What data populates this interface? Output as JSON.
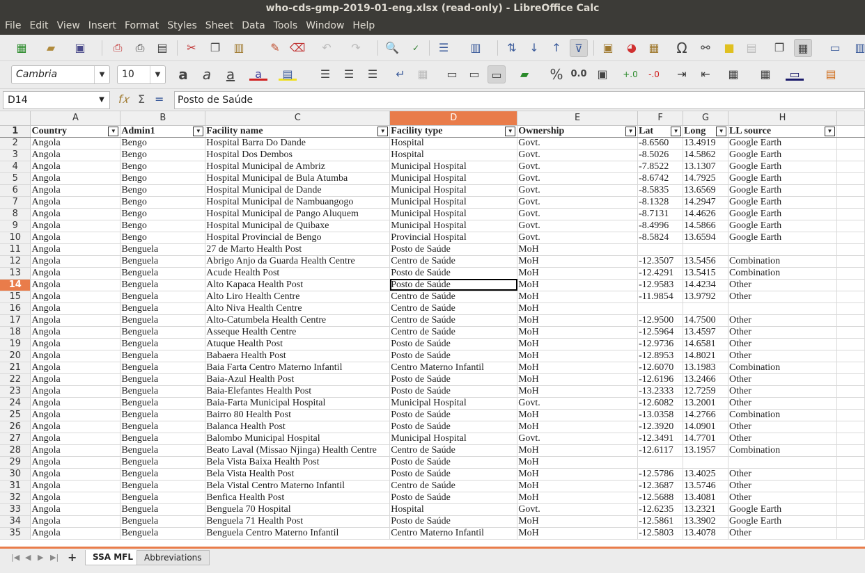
{
  "window": {
    "title": "who-cds-gmp-2019-01-eng.xlsx (read-only) - LibreOffice Calc"
  },
  "menu": [
    "File",
    "Edit",
    "View",
    "Insert",
    "Format",
    "Styles",
    "Sheet",
    "Data",
    "Tools",
    "Window",
    "Help"
  ],
  "format_toolbar": {
    "font_name": "Cambria",
    "font_size": "10"
  },
  "formula_bar": {
    "cell_ref": "D14",
    "content": "Posto de Saúde"
  },
  "columns": [
    "A",
    "B",
    "C",
    "D",
    "E",
    "F",
    "G",
    "H"
  ],
  "selected_column": "D",
  "selected_row": "14",
  "headers": [
    "Country",
    "Admin1",
    "Facility name",
    "Facility type",
    "Ownership",
    "Lat",
    "Long",
    "LL source"
  ],
  "rows": [
    [
      "2",
      "Angola",
      "Bengo",
      "Hospital Barra Do Dande",
      "Hospital",
      "Govt.",
      "-8.6560",
      "13.4919",
      "Google Earth"
    ],
    [
      "3",
      "Angola",
      "Bengo",
      "Hospital Dos Dembos",
      "Hospital",
      "Govt.",
      "-8.5026",
      "14.5862",
      "Google Earth"
    ],
    [
      "4",
      "Angola",
      "Bengo",
      "Hospital Municipal de Ambriz",
      "Municipal Hospital",
      "Govt.",
      "-7.8522",
      "13.1307",
      "Google Earth"
    ],
    [
      "5",
      "Angola",
      "Bengo",
      "Hospital Municipal de Bula Atumba",
      "Municipal Hospital",
      "Govt.",
      "-8.6742",
      "14.7925",
      "Google Earth"
    ],
    [
      "6",
      "Angola",
      "Bengo",
      "Hospital Municipal de Dande",
      "Municipal Hospital",
      "Govt.",
      "-8.5835",
      "13.6569",
      "Google Earth"
    ],
    [
      "7",
      "Angola",
      "Bengo",
      "Hospital Municipal de Nambuangogo",
      "Municipal Hospital",
      "Govt.",
      "-8.1328",
      "14.2947",
      "Google Earth"
    ],
    [
      "8",
      "Angola",
      "Bengo",
      "Hospital Municipal de Pango Aluquem",
      "Municipal Hospital",
      "Govt.",
      "-8.7131",
      "14.4626",
      "Google Earth"
    ],
    [
      "9",
      "Angola",
      "Bengo",
      "Hospital Municipal de Quibaxe",
      "Municipal Hospital",
      "Govt.",
      "-8.4996",
      "14.5866",
      "Google Earth"
    ],
    [
      "10",
      "Angola",
      "Bengo",
      "Hospital Provincial de Bengo",
      "Provincial Hospital",
      "Govt.",
      "-8.5824",
      "13.6594",
      "Google Earth"
    ],
    [
      "11",
      "Angola",
      "Benguela",
      "27 de Marto Health Post",
      "Posto de Saúde",
      "MoH",
      "",
      "",
      ""
    ],
    [
      "12",
      "Angola",
      "Benguela",
      "Abrigo Anjo da Guarda Health Centre",
      "Centro de Saúde",
      "MoH",
      "-12.3507",
      "13.5456",
      "Combination"
    ],
    [
      "13",
      "Angola",
      "Benguela",
      "Acude Health Post",
      "Posto de Saúde",
      "MoH",
      "-12.4291",
      "13.5415",
      "Combination"
    ],
    [
      "14",
      "Angola",
      "Benguela",
      "Alto Kapaca Health Post",
      "Posto de Saúde",
      "MoH",
      "-12.9583",
      "14.4234",
      "Other"
    ],
    [
      "15",
      "Angola",
      "Benguela",
      "Alto Liro Health Centre",
      "Centro de Saúde",
      "MoH",
      "-11.9854",
      "13.9792",
      "Other"
    ],
    [
      "16",
      "Angola",
      "Benguela",
      "Alto Niva Health Centre",
      "Centro de Saúde",
      "MoH",
      "",
      "",
      ""
    ],
    [
      "17",
      "Angola",
      "Benguela",
      "Alto-Catumbela Health Centre",
      "Centro de Saúde",
      "MoH",
      "-12.9500",
      "14.7500",
      "Other"
    ],
    [
      "18",
      "Angola",
      "Benguela",
      "Asseque Health Centre",
      "Centro de Saúde",
      "MoH",
      "-12.5964",
      "13.4597",
      "Other"
    ],
    [
      "19",
      "Angola",
      "Benguela",
      "Atuque Health Post",
      "Posto de Saúde",
      "MoH",
      "-12.9736",
      "14.6581",
      "Other"
    ],
    [
      "20",
      "Angola",
      "Benguela",
      "Babaera Health Post",
      "Posto de Saúde",
      "MoH",
      "-12.8953",
      "14.8021",
      "Other"
    ],
    [
      "21",
      "Angola",
      "Benguela",
      "Baia Farta Centro Materno Infantil",
      "Centro Materno Infantil",
      "MoH",
      "-12.6070",
      "13.1983",
      "Combination"
    ],
    [
      "22",
      "Angola",
      "Benguela",
      "Baia-Azul Health Post",
      "Posto de Saúde",
      "MoH",
      "-12.6196",
      "13.2466",
      "Other"
    ],
    [
      "23",
      "Angola",
      "Benguela",
      "Baia-Elefantes Health Post",
      "Posto de Saúde",
      "MoH",
      "-13.2333",
      "12.7259",
      "Other"
    ],
    [
      "24",
      "Angola",
      "Benguela",
      "Baia-Farta Municipal Hospital",
      "Municipal Hospital",
      "Govt.",
      "-12.6082",
      "13.2001",
      "Other"
    ],
    [
      "25",
      "Angola",
      "Benguela",
      "Bairro 80 Health Post",
      "Posto de Saúde",
      "MoH",
      "-13.0358",
      "14.2766",
      "Combination"
    ],
    [
      "26",
      "Angola",
      "Benguela",
      "Balanca Health Post",
      "Posto de Saúde",
      "MoH",
      "-12.3920",
      "14.0901",
      "Other"
    ],
    [
      "27",
      "Angola",
      "Benguela",
      "Balombo Municipal Hospital",
      "Municipal Hospital",
      "Govt.",
      "-12.3491",
      "14.7701",
      "Other"
    ],
    [
      "28",
      "Angola",
      "Benguela",
      "Beato Laval (Missao Njinga) Health Centre",
      "Centro de Saúde",
      "MoH",
      "-12.6117",
      "13.1957",
      "Combination"
    ],
    [
      "29",
      "Angola",
      "Benguela",
      "Bela Vista Baixa Health Post",
      "Posto de Saúde",
      "MoH",
      "",
      "",
      ""
    ],
    [
      "30",
      "Angola",
      "Benguela",
      "Bela Vista Health Post",
      "Posto de Saúde",
      "MoH",
      "-12.5786",
      "13.4025",
      "Other"
    ],
    [
      "31",
      "Angola",
      "Benguela",
      "Bela Vistal  Centro Materno Infantil",
      "Centro de Saúde",
      "MoH",
      "-12.3687",
      "13.5746",
      "Other"
    ],
    [
      "32",
      "Angola",
      "Benguela",
      "Benfica Health Post",
      "Posto de Saúde",
      "MoH",
      "-12.5688",
      "13.4081",
      "Other"
    ],
    [
      "33",
      "Angola",
      "Benguela",
      "Benguela 70 Hospital",
      "Hospital",
      "Govt.",
      "-12.6235",
      "13.2321",
      "Google Earth"
    ],
    [
      "34",
      "Angola",
      "Benguela",
      "Benguela 71 Health Post",
      "Posto de Saúde",
      "MoH",
      "-12.5861",
      "13.3902",
      "Google Earth"
    ],
    [
      "35",
      "Angola",
      "Benguela",
      "Benguela Centro Materno Infantil",
      "Centro Materno Infantil",
      "MoH",
      "-12.5803",
      "13.4078",
      "Other"
    ]
  ],
  "sheet_tabs": [
    "SSA MFL",
    "Abbreviations"
  ],
  "active_tab": "SSA MFL"
}
